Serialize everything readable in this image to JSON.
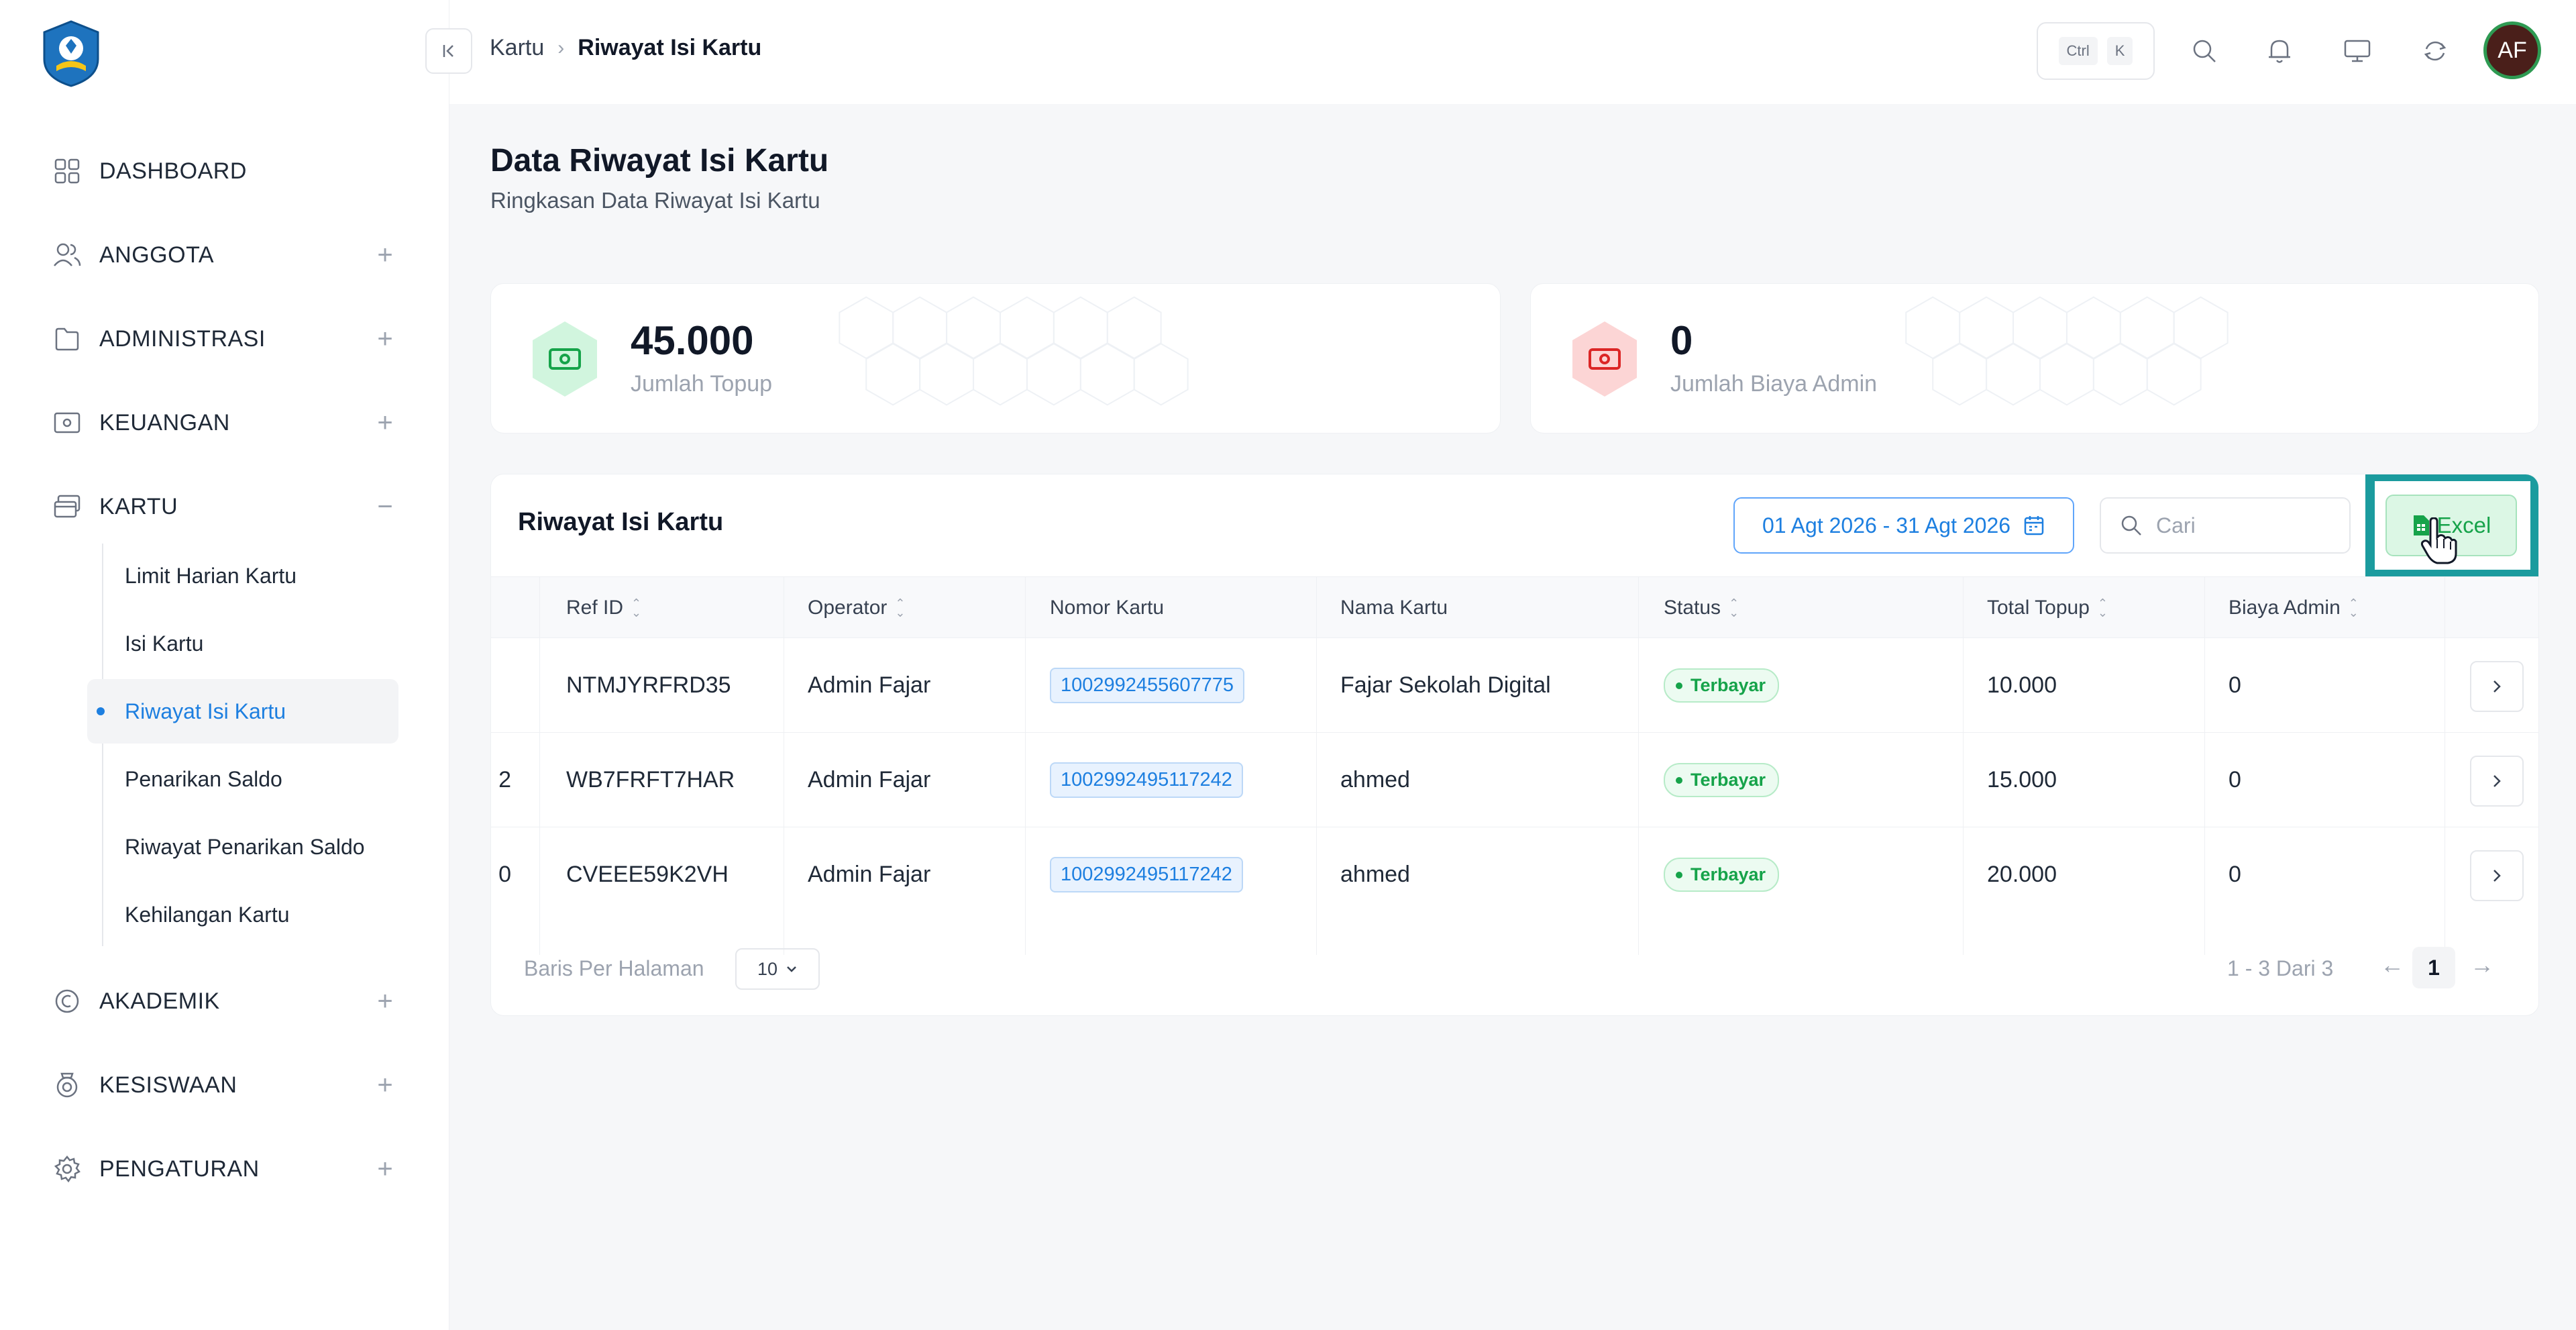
{
  "sidebar": {
    "items": [
      {
        "label": "DASHBOARD",
        "icon": "grid-icon",
        "toggle": ""
      },
      {
        "label": "ANGGOTA",
        "icon": "users-icon",
        "toggle": "+"
      },
      {
        "label": "ADMINISTRASI",
        "icon": "folder-icon",
        "toggle": "+"
      },
      {
        "label": "KEUANGAN",
        "icon": "money-icon",
        "toggle": "+"
      },
      {
        "label": "KARTU",
        "icon": "card-icon",
        "toggle": "−"
      },
      {
        "label": "AKADEMIK",
        "icon": "academic-icon",
        "toggle": "+"
      },
      {
        "label": "KESISWAAN",
        "icon": "student-icon",
        "toggle": "+"
      },
      {
        "label": "PENGATURAN",
        "icon": "gear-icon",
        "toggle": "+"
      }
    ],
    "kartu_sub": [
      "Limit Harian Kartu",
      "Isi Kartu",
      "Riwayat Isi Kartu",
      "Penarikan Saldo",
      "Riwayat Penarikan Saldo",
      "Kehilangan Kartu"
    ],
    "active_sub": "Riwayat Isi Kartu"
  },
  "topbar": {
    "breadcrumb": {
      "parent": "Kartu",
      "current": "Riwayat Isi Kartu"
    },
    "shortcut": {
      "key1": "Ctrl",
      "key2": "K"
    },
    "avatar_initials": "AF"
  },
  "page": {
    "title": "Data Riwayat Isi Kartu",
    "subtitle": "Ringkasan Data Riwayat Isi Kartu"
  },
  "stats": [
    {
      "value": "45.000",
      "label": "Jumlah Topup",
      "accent": "#22c55e"
    },
    {
      "value": "0",
      "label": "Jumlah Biaya Admin",
      "accent": "#ef4444"
    }
  ],
  "table": {
    "title": "Riwayat Isi Kartu",
    "date_range": "01 Agt 2026 - 31 Agt 2026",
    "search_placeholder": "Cari",
    "export_label": "Excel",
    "columns": [
      "Ref ID",
      "Operator",
      "Nomor Kartu",
      "Nama Kartu",
      "Status",
      "Total Topup",
      "Biaya Admin"
    ],
    "rows": [
      {
        "edge": "",
        "ref_id": "NTMJYRFRD35",
        "operator": "Admin Fajar",
        "card_no": "1002992455607775",
        "card_name": "Fajar Sekolah Digital",
        "status": "Terbayar",
        "total_topup": "10.000",
        "admin_fee": "0"
      },
      {
        "edge": "2",
        "ref_id": "WB7FRFT7HAR",
        "operator": "Admin Fajar",
        "card_no": "1002992495117242",
        "card_name": "ahmed",
        "status": "Terbayar",
        "total_topup": "15.000",
        "admin_fee": "0"
      },
      {
        "edge": "0",
        "ref_id": "CVEEE59K2VH",
        "operator": "Admin Fajar",
        "card_no": "1002992495117242",
        "card_name": "ahmed",
        "status": "Terbayar",
        "total_topup": "20.000",
        "admin_fee": "0"
      }
    ],
    "footer": {
      "rows_per_page_label": "Baris Per Halaman",
      "rows_per_page": "10",
      "page_info": "1 - 3 Dari 3",
      "current_page": "1",
      "prev": "←",
      "next": "→"
    }
  },
  "colors": {
    "accent": "#1d7fe0",
    "success": "#16a34a",
    "highlight": "#1b9b9e"
  }
}
